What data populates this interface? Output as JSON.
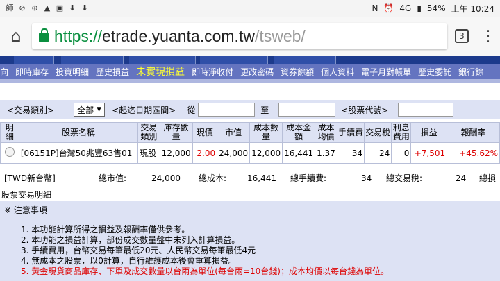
{
  "status_bar": {
    "left_icons": [
      "師",
      "⊘",
      "⊕",
      "▲",
      "▣",
      "⬇",
      "⬇"
    ],
    "right_icons": [
      "N",
      "⏰",
      "4G",
      "▮"
    ],
    "battery": "54%",
    "time": "上午 10:24"
  },
  "browser": {
    "url_scheme": "https://",
    "url_host": "etrade.yuanta.com.tw",
    "url_path": "/tsweb/",
    "tab_count": "3"
  },
  "menu": {
    "items": [
      "向",
      "即時庫存",
      "投資明細",
      "歷史損益",
      "未實現損益",
      "即時淨收付",
      "更改密碼",
      "資券餘額",
      "個人資料",
      "電子月對帳單",
      "歷史委託",
      "銀行餘"
    ],
    "active_index": 4
  },
  "filter": {
    "trade_type_label": "<交易類別>",
    "trade_type_value": "全部",
    "date_range_label": "<起迄日期區間>",
    "from_label": "從",
    "to_label": "至",
    "stock_code_label": "<股票代號>"
  },
  "table": {
    "headers": [
      "明細",
      "股票名稱",
      "交易類別",
      "庫存數量",
      "現價",
      "市值",
      "成本數量",
      "成本金額",
      "成本均價",
      "手續費",
      "交易稅",
      "利息費用",
      "損益",
      "報酬率"
    ],
    "rows": [
      {
        "stock_name": "[06151P]台灣50兆豐63售01",
        "trade_type": "現股",
        "inventory": "12,000",
        "price": "2.00",
        "market_value": "24,000",
        "cost_qty": "12,000",
        "cost_amount": "16,441",
        "avg_cost": "1.37",
        "fee": "34",
        "tax": "24",
        "interest": "0",
        "pnl": "+7,501",
        "return_rate": "+45.62%"
      }
    ]
  },
  "summary": {
    "currency": "[TWD新台幣]",
    "market_value_label": "總市值:",
    "market_value": "24,000",
    "cost_label": "總成本:",
    "cost": "16,441",
    "fee_label": "總手續費:",
    "fee": "34",
    "tax_label": "總交易稅:",
    "tax": "24",
    "pnl_label": "總損"
  },
  "section_title": "股票交易明細",
  "notes": {
    "title": "※ 注意事項",
    "items": [
      "1. 本功能計算所得之損益及報酬率僅供參考。",
      "2. 本功能之損益計算，部份成交數量盤中未列入計算損益。",
      "3. 手續費用，台幣交易每筆最低20元、人民幣交易每筆最低4元",
      "4. 無成本之股票，以0計算，自行維護成本後會重算損益。",
      "5. 黃金現貨商品庫存、下單及成交數量以台兩為單位(每台兩=10台錢)；成本均價以每台錢為單位。"
    ]
  }
}
